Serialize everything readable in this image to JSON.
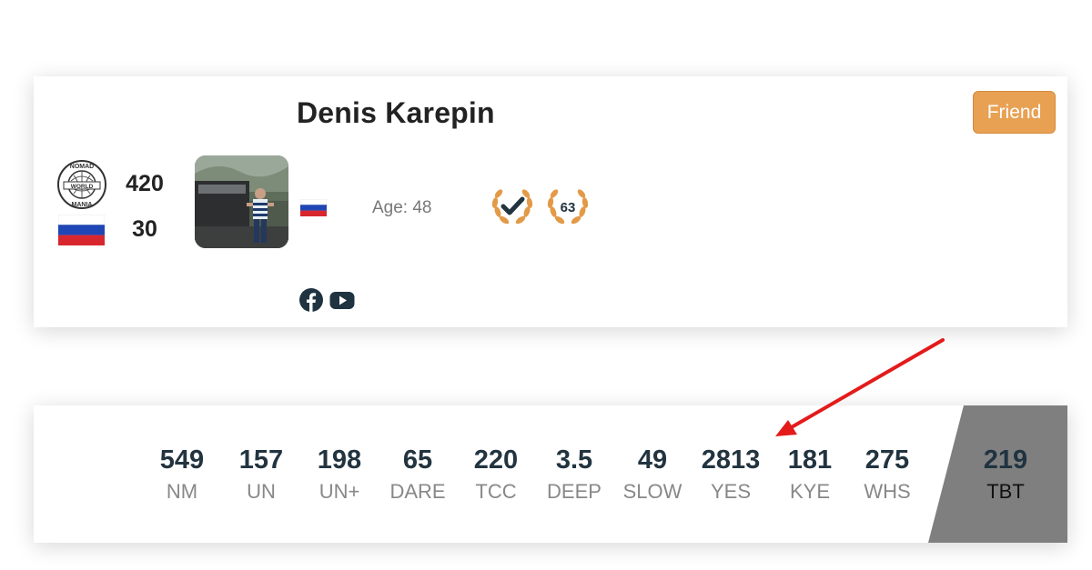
{
  "profile": {
    "name": "Denis Karepin",
    "friend_label": "Friend",
    "nm_score": "420",
    "country_score": "30",
    "age_text": "Age: 48",
    "badge_number": "63",
    "logo_text_top": "NOMAD",
    "logo_text_mid": "WORLD",
    "logo_text_bottom": "MANIA"
  },
  "stats": [
    {
      "value": "549",
      "label": "NM"
    },
    {
      "value": "157",
      "label": "UN"
    },
    {
      "value": "198",
      "label": "UN+"
    },
    {
      "value": "65",
      "label": "DARE"
    },
    {
      "value": "220",
      "label": "TCC"
    },
    {
      "value": "3.5",
      "label": "DEEP"
    },
    {
      "value": "49",
      "label": "SLOW"
    },
    {
      "value": "2813",
      "label": "YES"
    },
    {
      "value": "181",
      "label": "KYE"
    },
    {
      "value": "275",
      "label": "WHS"
    },
    {
      "value": "219",
      "label": "TBT"
    }
  ],
  "colors": {
    "friend_button": "#e8a153",
    "laurel": "#e39a47",
    "stat_value": "#22343f",
    "tbt_highlight": "#7f7f7f",
    "arrow": "#e31b1b"
  },
  "icons": [
    "nomadmania-logo-icon",
    "russia-flag-icon",
    "check-laurel-icon",
    "laurel-63-icon",
    "facebook-icon",
    "youtube-icon"
  ]
}
